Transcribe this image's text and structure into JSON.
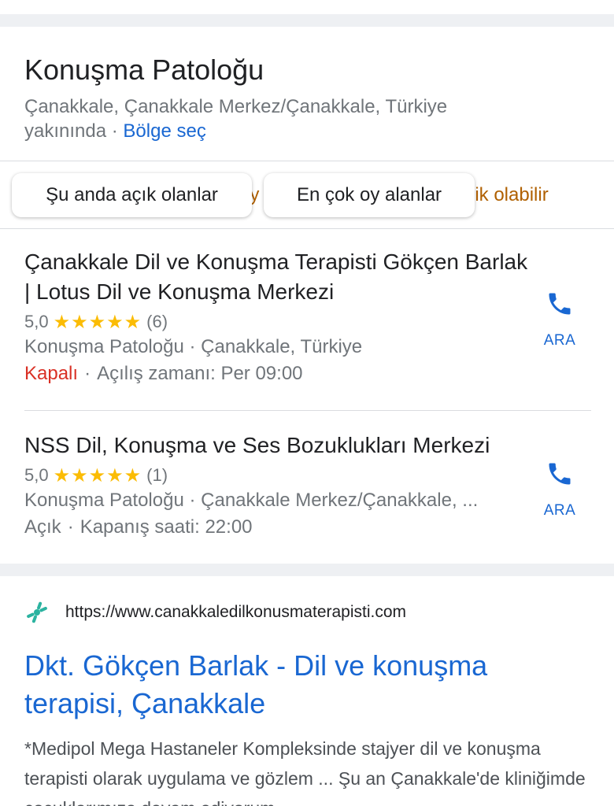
{
  "header": {
    "title": "Konuşma Patoloğu",
    "location_text": "Çanakkale, Çanakkale Merkez/Çanakkale, Türkiye",
    "location_suffix": "yakınında",
    "dot": "·",
    "region_link": "Bölge seç"
  },
  "chips": [
    {
      "label": "Şu anda açık olanlar"
    },
    {
      "label": "En çok oy alanlar"
    }
  ],
  "chip_hidden": {
    "fragment_a": "iy",
    "fragment_b": "lik olabilir"
  },
  "results": [
    {
      "name": "Çanakkale Dil ve Konuşma Terapisti Gökçen Barlak | Lotus Dil ve Konuşma Merkezi",
      "rating": "5,0",
      "stars": "★★★★★",
      "reviews": "(6)",
      "category": "Konuşma Patoloğu · Çanakkale, Türkiye",
      "status": "Kapalı",
      "status_color": "#d93025",
      "hours": "Açılış zamanı: Per 09:00",
      "call_label": "ARA"
    },
    {
      "name": "NSS Dil, Konuşma ve Ses Bozuklukları Merkezi",
      "rating": "5,0",
      "stars": "★★★★★",
      "reviews": "(1)",
      "category": "Konuşma Patoloğu · Çanakkale Merkez/Çanakkale, ...",
      "status": "Açık",
      "status_color": "#70757a",
      "hours": "Kapanış saati: 22:00",
      "call_label": "ARA"
    }
  ],
  "web_result": {
    "url": "https://www.canakkaledilkonusmaterapisti.com",
    "title": "Dkt. Gökçen Barlak - Dil ve konuşma terapisi, Çanakkale",
    "snippet": "*Medipol Mega Hastaneler Kompleksinde stajyer dil ve konuşma terapisti olarak uygulama ve gözlem ... Şu an Çanakkale'de kliniğimde çocuklarımıza devam ediyorum"
  },
  "colors": {
    "accent": "#1967d2",
    "star": "#fbbc04",
    "closed": "#d93025",
    "favicon": "#2bb3a0"
  }
}
